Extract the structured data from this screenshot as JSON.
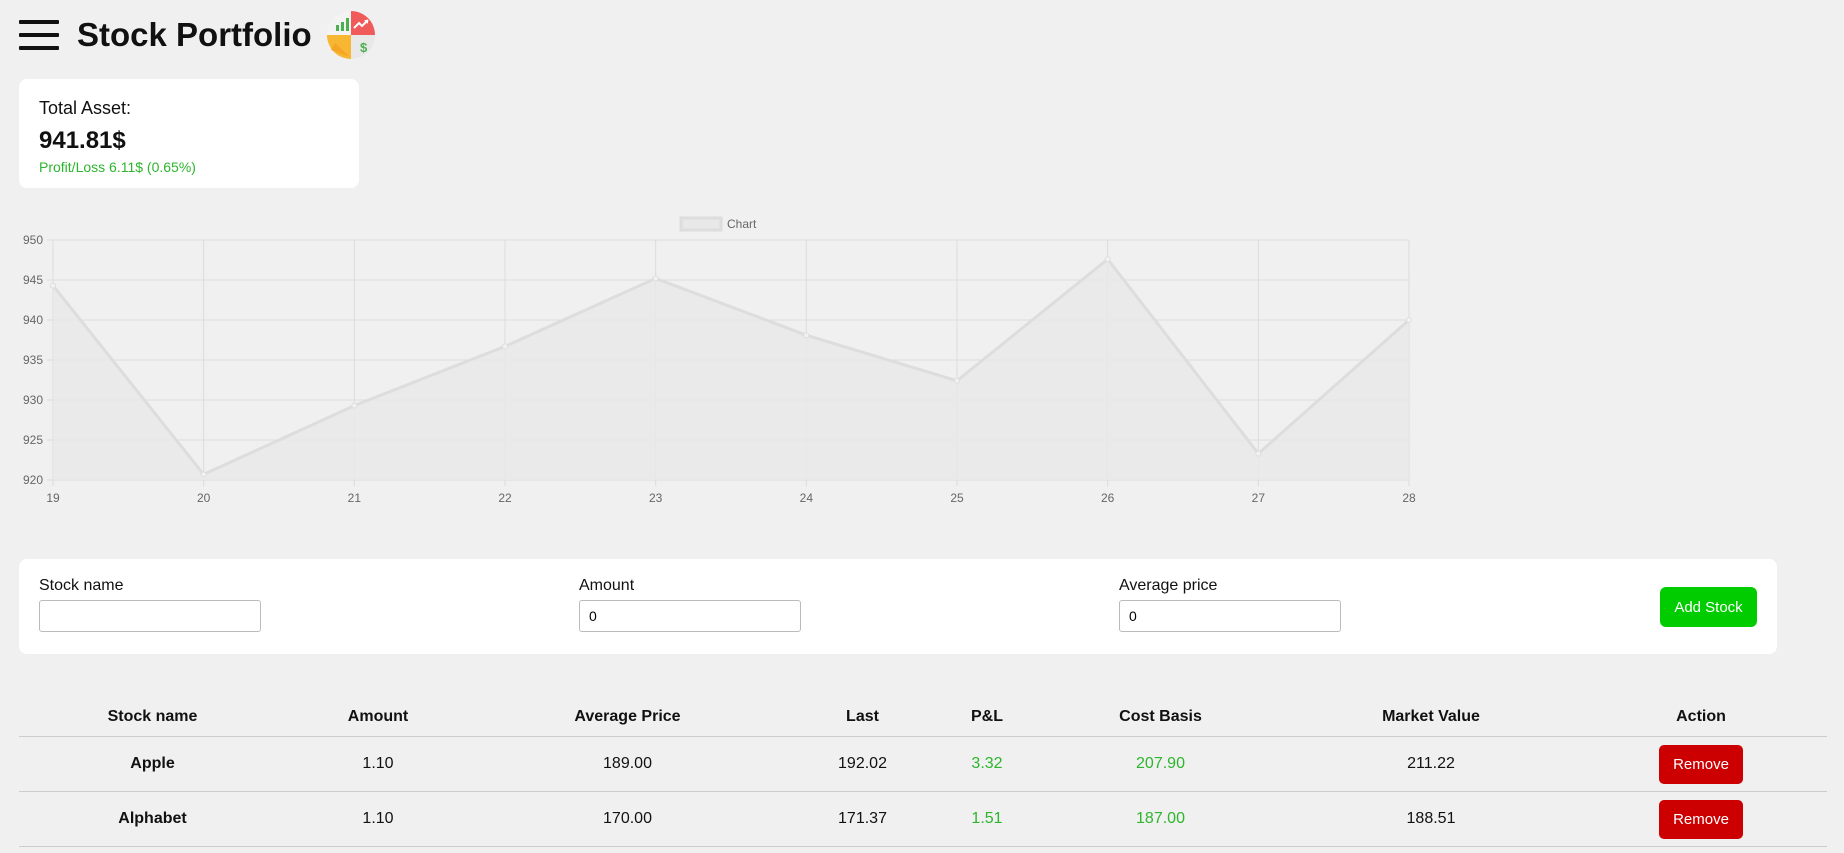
{
  "header": {
    "title": "Stock Portfolio"
  },
  "summary": {
    "label": "Total Asset:",
    "value": "941.81$",
    "profit_loss": "Profit/Loss 6.11$ (0.65%)"
  },
  "chart_data": {
    "type": "line",
    "legend": [
      "Chart"
    ],
    "legend_position": "top",
    "grid": true,
    "x": [
      19,
      20,
      21,
      22,
      23,
      24,
      25,
      26,
      27,
      28
    ],
    "series": [
      {
        "name": "Chart",
        "values": [
          944.3,
          920.7,
          929.3,
          936.7,
          945.2,
          938.1,
          932.4,
          947.6,
          923.3,
          940.0
        ]
      }
    ],
    "ylim": [
      920,
      950
    ],
    "yticks": [
      950,
      945,
      940,
      935,
      930,
      925,
      920
    ],
    "xticks": [
      19,
      20,
      21,
      22,
      23,
      24,
      25,
      26,
      27,
      28
    ],
    "fill": true,
    "colors": {
      "line": "#dddddd",
      "fill": "#e8e8e8",
      "grid": "#dcdcdc"
    }
  },
  "form": {
    "stock_name_label": "Stock name",
    "stock_name_value": "",
    "amount_label": "Amount",
    "amount_value": "0",
    "avg_price_label": "Average price",
    "avg_price_value": "0",
    "add_button": "Add Stock"
  },
  "table": {
    "headers": [
      "Stock name",
      "Amount",
      "Average Price",
      "Last",
      "P&L",
      "Cost Basis",
      "Market Value",
      "Action"
    ],
    "rows": [
      {
        "name": "Apple",
        "amount": "1.10",
        "avg_price": "189.00",
        "last": "192.02",
        "pl": "3.32",
        "cost_basis": "207.90",
        "market_value": "211.22",
        "action": "Remove"
      },
      {
        "name": "Alphabet",
        "amount": "1.10",
        "avg_price": "170.00",
        "last": "171.37",
        "pl": "1.51",
        "cost_basis": "187.00",
        "market_value": "188.51",
        "action": "Remove"
      }
    ]
  },
  "colors": {
    "positive": "#2db52d",
    "add_button": "#00cc00",
    "remove_button": "#cc0000",
    "background": "#f0f0f0"
  },
  "icons": {
    "menu": "hamburger-menu-icon",
    "logo": "portfolio-chart-logo-icon"
  }
}
